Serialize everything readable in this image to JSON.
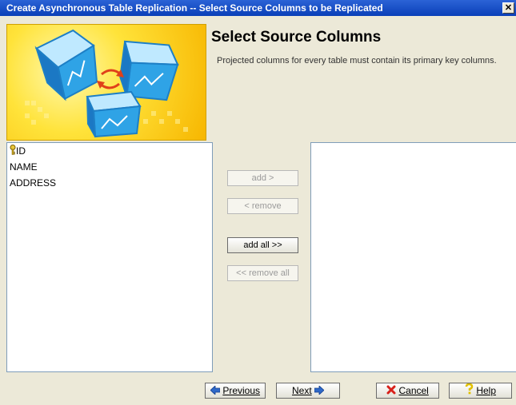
{
  "window": {
    "title": "Create Asynchronous Table Replication -- Select Source Columns to be Replicated",
    "close_glyph": "✕"
  },
  "header": {
    "heading": "Select Source Columns",
    "description": "Projected columns for every table must contain its primary key columns."
  },
  "source_columns": [
    {
      "label": "ID",
      "primary_key": true,
      "icon": "key-icon"
    },
    {
      "label": "NAME",
      "primary_key": false
    },
    {
      "label": "ADDRESS",
      "primary_key": false
    }
  ],
  "selected_columns": [],
  "transfer_buttons": {
    "add": {
      "label": "add >",
      "enabled": false
    },
    "remove": {
      "label": "< remove",
      "enabled": false
    },
    "add_all": {
      "label": "add all >>",
      "enabled": true
    },
    "remove_all": {
      "label": "<< remove all",
      "enabled": false
    }
  },
  "nav_buttons": {
    "previous": {
      "label": "Previous",
      "icon": "arrow-left-icon"
    },
    "next": {
      "label": "Next",
      "icon": "arrow-right-icon"
    },
    "cancel": {
      "label": "Cancel",
      "icon": "red-x-icon"
    },
    "help": {
      "label": "Help",
      "icon": "question-mark-icon"
    }
  },
  "colors": {
    "title_bar": "#0a3fb8",
    "window_bg": "#ece9d8",
    "banner_yellow": "#ffe33a",
    "list_border": "#7f9db9"
  }
}
